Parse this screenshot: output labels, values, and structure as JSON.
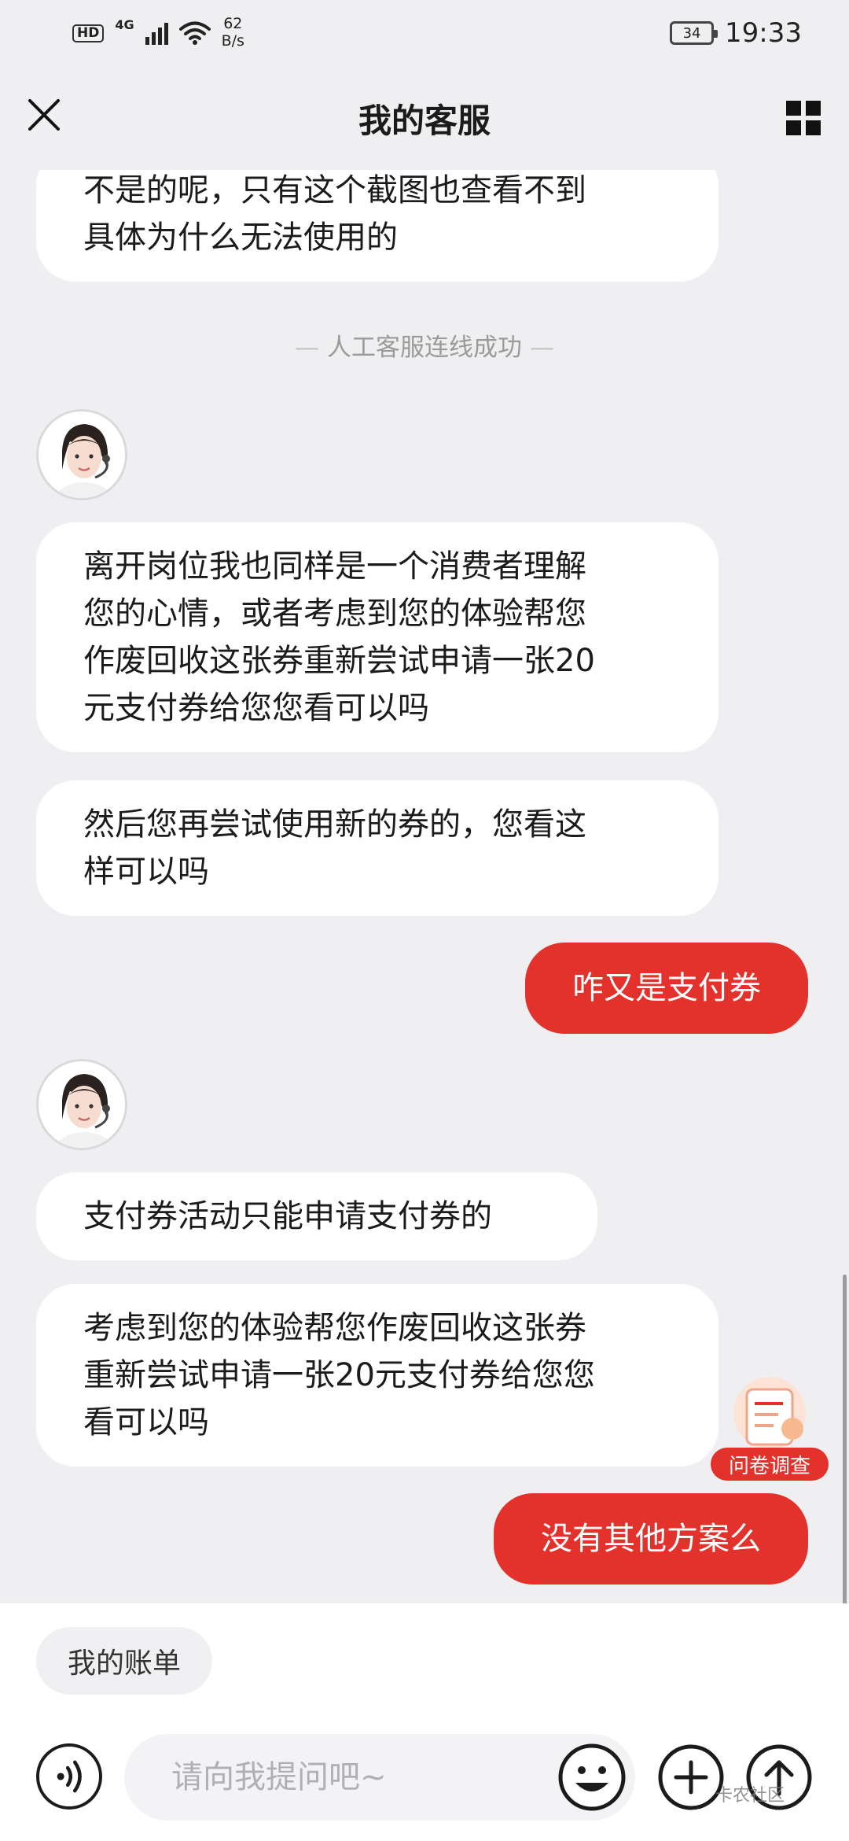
{
  "status_bar": {
    "hd": "HD",
    "net_gen": "4G",
    "speed_value": "62",
    "speed_unit": "B/s",
    "battery": "34",
    "time": "19:33"
  },
  "nav": {
    "title": "我的客服",
    "close_icon": "close-icon",
    "menu_icon": "grid-icon"
  },
  "chat": {
    "messages": [
      {
        "from": "agent",
        "lines": [
          "不是的呢，只有这个截图也查看不到",
          "具体为什么无法使用的"
        ]
      },
      {
        "from": "agent",
        "lines": [
          "离开岗位我也同样是一个消费者理解",
          "您的心情，或者考虑到您的体验帮您",
          "作废回收这张券重新尝试申请一张20",
          "元支付券给您您看可以吗"
        ]
      },
      {
        "from": "agent",
        "lines": [
          "然后您再尝试使用新的券的，您看这",
          "样可以吗"
        ]
      },
      {
        "from": "user",
        "text": "咋又是支付券"
      },
      {
        "from": "agent",
        "lines": [
          "支付券活动只能申请支付券的"
        ]
      },
      {
        "from": "agent",
        "lines": [
          "考虑到您的体验帮您作废回收这张券",
          "重新尝试申请一张20元支付券给您您",
          "看可以吗"
        ]
      },
      {
        "from": "user",
        "text": "没有其他方案么"
      }
    ],
    "system_notice": "人工客服连线成功",
    "survey_label": "问卷调查"
  },
  "bottom": {
    "quick_reply": "我的账单",
    "input_placeholder": "请向我提问吧~",
    "watermark": "卡农社区"
  },
  "colors": {
    "accent": "#e3312b",
    "background": "#efeff1",
    "bubble": "#ffffff"
  }
}
